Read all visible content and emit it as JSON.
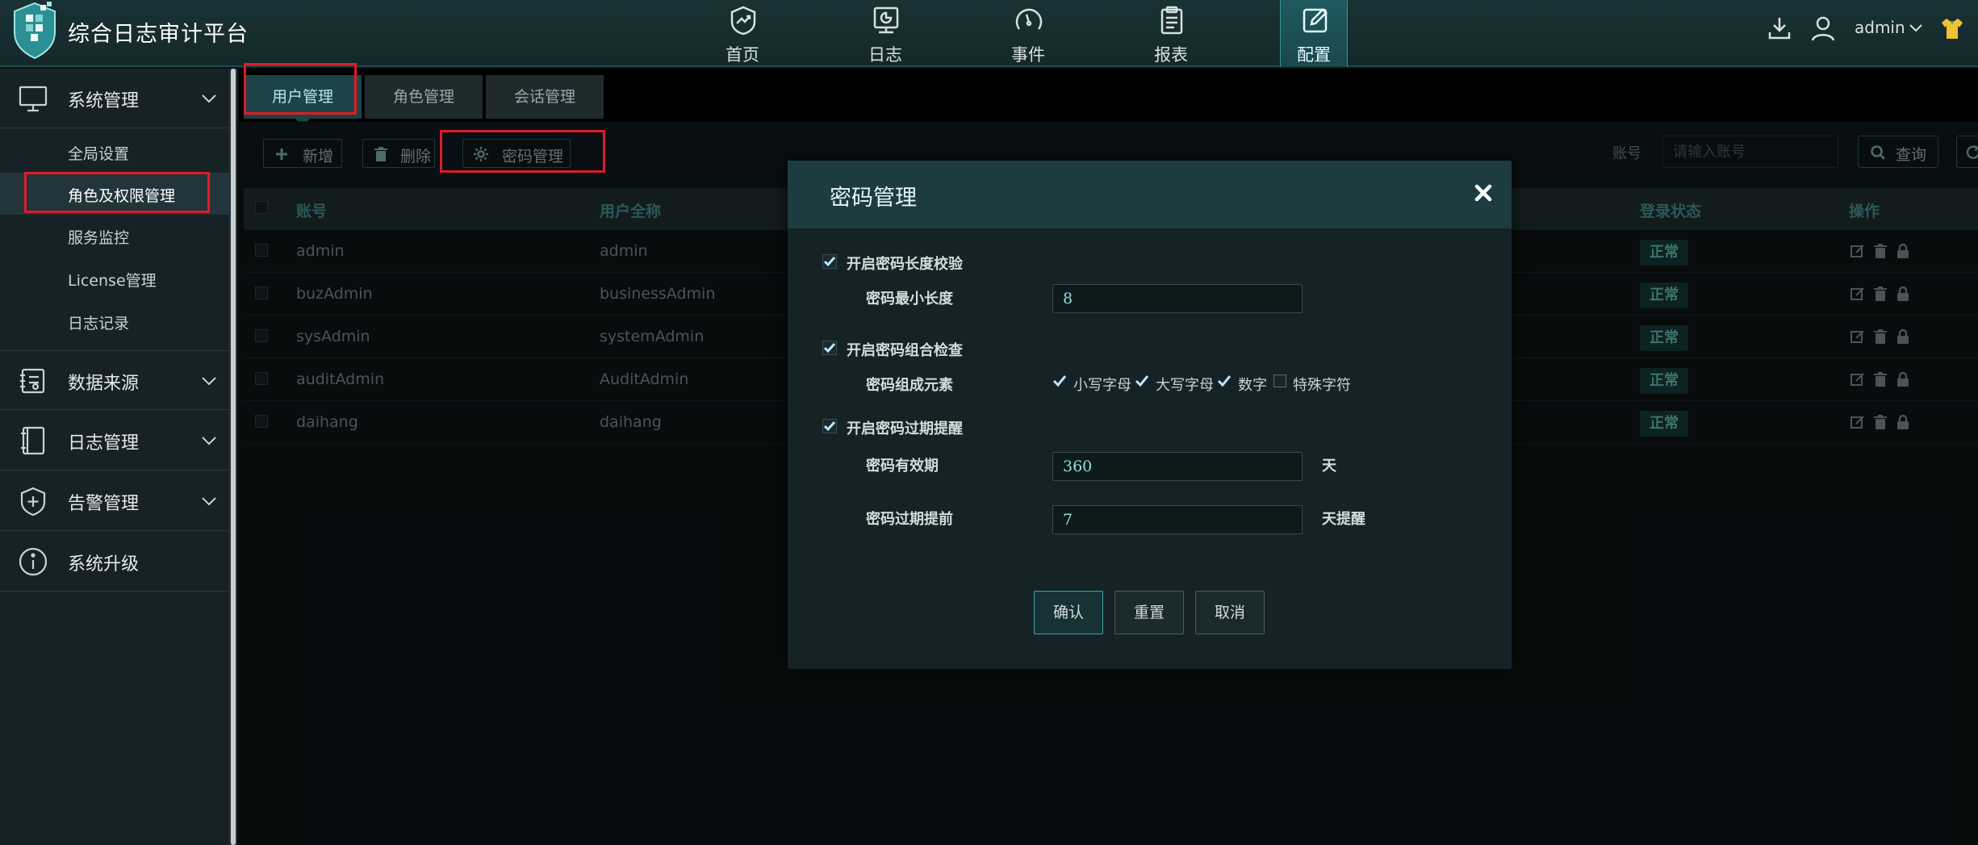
{
  "app": {
    "title": "综合日志审计平台"
  },
  "nav": {
    "items": [
      {
        "key": "home",
        "label": "首页"
      },
      {
        "key": "log",
        "label": "日志"
      },
      {
        "key": "event",
        "label": "事件"
      },
      {
        "key": "report",
        "label": "报表"
      },
      {
        "key": "config",
        "label": "配置"
      }
    ],
    "active": "config"
  },
  "user": {
    "name": "admin"
  },
  "sidebar": {
    "groups": [
      {
        "label": "系统管理",
        "icon": "monitor-icon",
        "expanded": true
      },
      {
        "label": "数据来源",
        "icon": "data-source-icon"
      },
      {
        "label": "日志管理",
        "icon": "notebook-icon"
      },
      {
        "label": "告警管理",
        "icon": "shield-plus-icon"
      },
      {
        "label": "系统升级",
        "icon": "info-icon"
      }
    ],
    "items": [
      {
        "label": "全局设置"
      },
      {
        "label": "角色及权限管理",
        "active": true
      },
      {
        "label": "服务监控"
      },
      {
        "label": "License管理"
      },
      {
        "label": "日志记录"
      }
    ]
  },
  "tabs": [
    {
      "label": "用户管理",
      "active": true
    },
    {
      "label": "角色管理"
    },
    {
      "label": "会话管理"
    }
  ],
  "toolbar": {
    "add_label": "新增",
    "delete_label": "删除",
    "password_label": "密码管理",
    "account_label": "账号",
    "account_placeholder": "请输入账号",
    "query_label": "查询"
  },
  "table": {
    "headers": {
      "account": "账号",
      "fullname": "用户全称",
      "login_status": "登录状态",
      "ops": "操作"
    },
    "rows": [
      {
        "account": "admin",
        "fullname": "admin",
        "status": "正常"
      },
      {
        "account": "buzAdmin",
        "fullname": "businessAdmin",
        "status": "正常"
      },
      {
        "account": "sysAdmin",
        "fullname": "systemAdmin",
        "status": "正常"
      },
      {
        "account": "auditAdmin",
        "fullname": "AuditAdmin",
        "status": "正常"
      },
      {
        "account": "daihang",
        "fullname": "daihang",
        "status": "正常"
      }
    ]
  },
  "modal": {
    "title": "密码管理",
    "length_check_label": "开启密码长度校验",
    "min_length_label": "密码最小长度",
    "min_length_value": "8",
    "combo_check_label": "开启密码组合检查",
    "combo_elements_label": "密码组成元素",
    "options": {
      "lower": "小写字母",
      "upper": "大写字母",
      "digit": "数字",
      "special": "特殊字符"
    },
    "expiry_check_label": "开启密码过期提醒",
    "validity_label": "密码有效期",
    "validity_value": "360",
    "validity_unit": "天",
    "advance_label": "密码过期提前",
    "advance_value": "7",
    "advance_unit": "天提醒",
    "confirm_label": "确认",
    "reset_label": "重置",
    "cancel_label": "取消"
  },
  "colors": {
    "accent": "#2d6a6d",
    "status_bg": "#18403f",
    "status_text": "#6fd1c8",
    "highlight": "#e01b24"
  }
}
